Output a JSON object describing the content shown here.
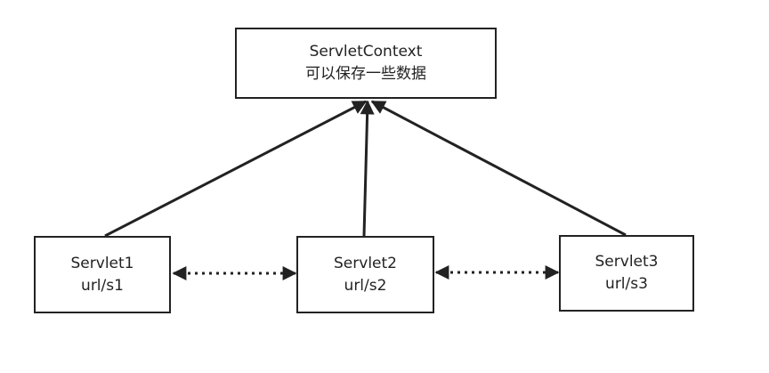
{
  "nodes": {
    "context": {
      "title": "ServletContext",
      "subtitle": "可以保存一些数据"
    },
    "servlet1": {
      "title": "Servlet1",
      "subtitle": "url/s1"
    },
    "servlet2": {
      "title": "Servlet2",
      "subtitle": "url/s2"
    },
    "servlet3": {
      "title": "Servlet3",
      "subtitle": "url/s3"
    }
  },
  "colors": {
    "stroke": "#222222",
    "background": "#ffffff"
  }
}
